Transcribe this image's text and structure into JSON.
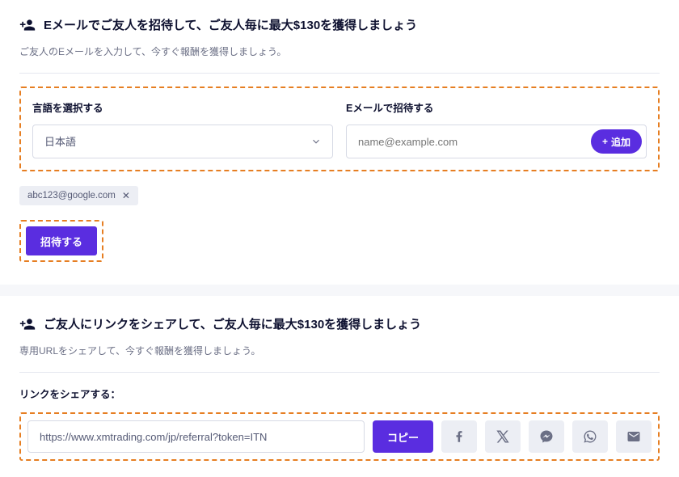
{
  "emailInvite": {
    "title": "Eメールでご友人を招待して、ご友人毎に最大$130を獲得しましょう",
    "subtitle": "ご友人のEメールを入力して、今すぐ報酬を獲得しましょう。",
    "langLabel": "言語を選択する",
    "langValue": "日本語",
    "emailLabel": "Eメールで招待する",
    "emailPlaceholder": "name@example.com",
    "addLabel": "追加",
    "chipEmail": "abc123@google.com",
    "inviteLabel": "招待する"
  },
  "linkShare": {
    "title": "ご友人にリンクをシェアして、ご友人毎に最大$130を獲得しましょう",
    "subtitle": "専用URLをシェアして、今すぐ報酬を獲得しましょう。",
    "shareLabel": "リンクをシェアする：",
    "url": "https://www.xmtrading.com/jp/referral?token=ITN",
    "copyLabel": "コピー"
  }
}
